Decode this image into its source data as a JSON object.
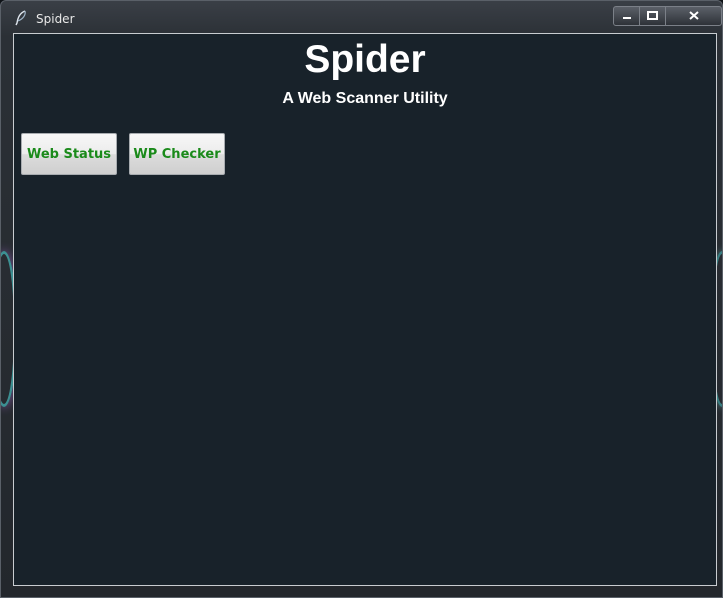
{
  "window": {
    "title": "Spider",
    "icon": "feather-icon",
    "controls": [
      "minimize-icon",
      "maximize-icon",
      "close-icon"
    ]
  },
  "app": {
    "title": "Spider",
    "subtitle": "A Web Scanner Utility"
  },
  "buttons": {
    "web_status": "Web Status",
    "wp_checker": "WP Checker"
  },
  "colors": {
    "background": "#18222a",
    "title_text": "#ffffff",
    "button_text": "#1a8a1a",
    "button_face": "#e6e6e6"
  }
}
